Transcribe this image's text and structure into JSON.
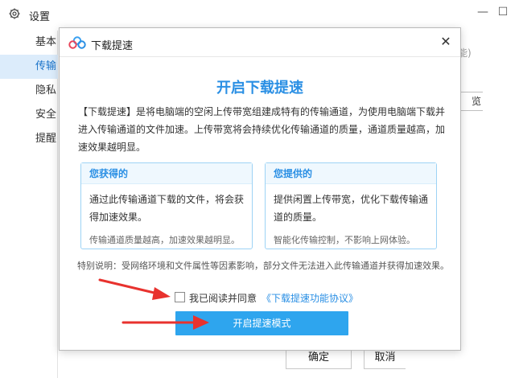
{
  "settings": {
    "title": "设置",
    "sidebar": [
      {
        "label": "基本",
        "active": false
      },
      {
        "label": "传输",
        "active": true
      },
      {
        "label": "隐私",
        "active": false
      },
      {
        "label": "安全",
        "active": false
      },
      {
        "label": "提醒",
        "active": false
      }
    ],
    "partial_hint": "能)",
    "partial_browse": "览",
    "ok_label": "确定",
    "cancel_label": "取消",
    "minimize_glyph": "—",
    "maximize_glyph": "☐"
  },
  "dialog": {
    "title": "下载提速",
    "close_glyph": "✕",
    "heading": "开启下载提速",
    "description": "【下载提速】是将电脑端的空闲上传带宽组建成特有的传输通道，为使用电脑端下载并进入传输通道的文件加速。上传带宽将会持续优化传输通道的质量，通道质量越高，加速效果越明显。",
    "cards": [
      {
        "title": "您获得的",
        "body": "通过此传输通道下载的文件，将会获得加速效果。",
        "footer": "传输通道质量越高，加速效果越明显。"
      },
      {
        "title": "您提供的",
        "body": "提供闲置上传带宽，优化下载传输通道的质量。",
        "footer": "智能化传输控制，不影响上网体验。"
      }
    ],
    "note": "特别说明：受网络环境和文件属性等因素影响，部分文件无法进入此传输通道并获得加速效果。",
    "agree_text": "我已阅读并同意",
    "agree_link": "《下载提速功能协议》",
    "agree_checked": false,
    "primary_button": "开启提速模式"
  },
  "colors": {
    "accent": "#2a8fe4",
    "button": "#2ea5ee",
    "annotation": "#e8322e",
    "sidebar_active_bg": "#dcecfb"
  }
}
